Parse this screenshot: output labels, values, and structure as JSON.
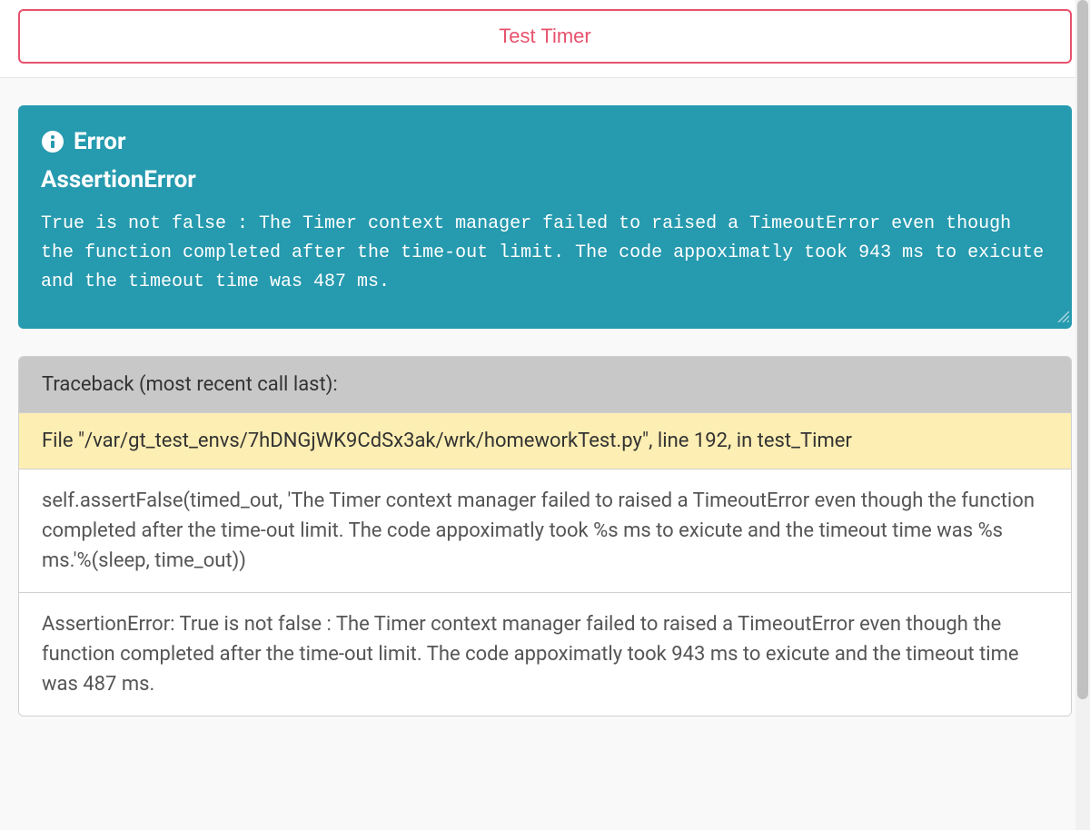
{
  "header": {
    "test_button_label": "Test Timer"
  },
  "error_panel": {
    "title": "Error",
    "exception_type": "AssertionError",
    "message": "True is not false : The Timer context manager failed to raised a TimeoutError even though the function completed after the time-out limit. The code appoximatly took 943 ms to exicute and the timeout time was 487 ms."
  },
  "traceback": {
    "header": "Traceback (most recent call last):",
    "file_line": "File \"/var/gt_test_envs/7hDNGjWK9CdSx3ak/wrk/homeworkTest.py\", line 192, in test_Timer",
    "code_line": "self.assertFalse(timed_out, 'The Timer context manager failed to raised a TimeoutError even though the function completed after the time-out limit. The code appoximatly took %s ms to exicute and the timeout time was %s ms.'%(sleep, time_out))",
    "assertion_line": "AssertionError: True is not false : The Timer context manager failed to raised a TimeoutError even though the function completed after the time-out limit. The code appoximatly took 943 ms to exicute and the timeout time was 487 ms."
  }
}
